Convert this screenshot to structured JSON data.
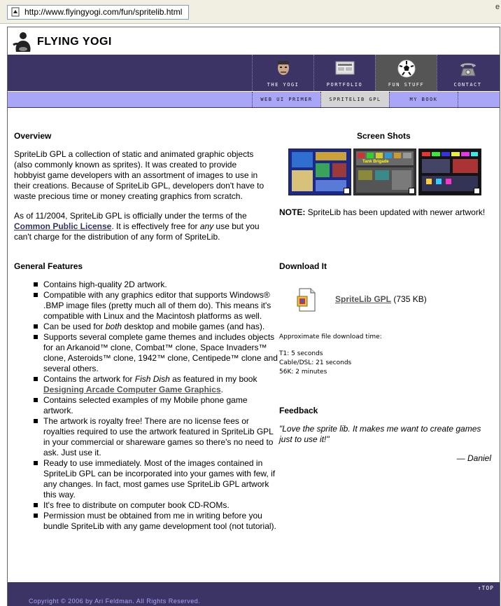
{
  "browser": {
    "url": "http://www.flyingyogi.com/fun/spritelib.html",
    "edge_text": "e"
  },
  "site": {
    "logo_text": "FLYING YOGI",
    "accent_color": "#3d3466",
    "subnav_color": "#a9a6f7"
  },
  "nav": [
    {
      "label": "THE YOGI",
      "icon": "face-icon"
    },
    {
      "label": "PORTFOLIO",
      "icon": "monitor-icon"
    },
    {
      "label": "FUN STUFF",
      "icon": "soccer-ball-icon"
    },
    {
      "label": "CONTACT",
      "icon": "telephone-icon"
    }
  ],
  "subnav": [
    {
      "label": "WEB UI PRIMER"
    },
    {
      "label": "SPRITELIB GPL"
    },
    {
      "label": "MY BOOK"
    }
  ],
  "overview": {
    "heading": "Overview",
    "p1": "SpriteLib GPL a collection of static and animated graphic objects (also commonly known as sprites). It was created to provide hobbyist game developers with an assortment of images to use in their creations. Because of SpriteLib GPL, developers don't have to waste precious time or money creating graphics from scratch.",
    "p2_before": "As of 11/2004, SpriteLib GPL is officially under the terms of the ",
    "p2_link": "Common Public License",
    "p2_mid": ". It is effectively free for ",
    "p2_em": "any",
    "p2_after": " use but you can't charge for the distribution of any form of SpriteLib."
  },
  "screenshots": {
    "heading": "Screen Shots",
    "note_label": "NOTE:",
    "note_text": " SpriteLib has been updated with newer artwork!",
    "caption2": "Tank Brigade"
  },
  "features": {
    "heading": "General Features",
    "items": [
      {
        "text": "Contains high-quality 2D artwork."
      },
      {
        "text": "Compatible with any graphics editor that supports Windows® .BMP image files (pretty much all of them do). This means it's compatible with Linux and the Macintosh platforms as well."
      },
      {
        "a": "Can be used for ",
        "em": "both",
        "b": " desktop and mobile games (and has)."
      },
      {
        "text": "Supports several complete game themes and includes objects for an Arkanoid™ clone, Combat™ clone, Space Invaders™ clone, Asteroids™ clone, 1942™ clone, Centipede™ clone and several others."
      },
      {
        "a": "Contains the artwork for ",
        "em": "Fish Dish",
        "b": " as featured in my book ",
        "link": "Designing Arcade Computer Game Graphics",
        "c": "."
      },
      {
        "text": "Contains selected examples of my Mobile phone game artwork."
      },
      {
        "text": "The artwork is royalty free! There are no license fees or royalties required to use the artwork featured in SpriteLib GPL in your commercial or shareware games so there's no need to ask. Just use it."
      },
      {
        "text": "Ready to use immediately. Most of the images contained in SpriteLib GPL can be incorporated into your games with few, if any changes. In fact, most games use SpriteLib GPL artwork this way."
      },
      {
        "text": "It's free to distribute on computer book CD-ROMs."
      },
      {
        "text": "Permission must be obtained from me in writing before you bundle SpriteLib with any game development tool (not tutorial)."
      }
    ]
  },
  "download": {
    "heading": "Download It",
    "link": "SpriteLib GPL",
    "size": " (735 KB)",
    "time_label": "Approximate file download time:",
    "t1": "T1: 5 seconds",
    "cable": "Cable/DSL: 21 seconds",
    "k56": "56K: 2 minutes"
  },
  "feedback": {
    "heading": "Feedback",
    "quote": "\"Love the sprite lib. It makes me want to create games just to use it!\"",
    "author": "— Daniel"
  },
  "footer": {
    "top_label": "TOP",
    "copyright": "Copyright © 2006 by Ari Feldman. All Rights Reserved."
  }
}
